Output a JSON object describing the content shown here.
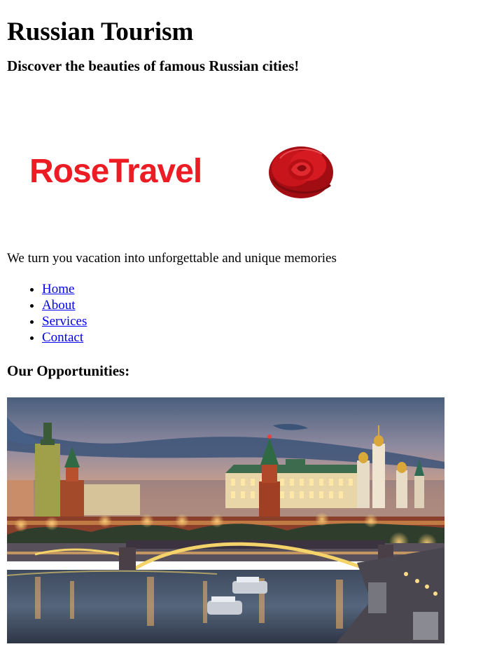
{
  "header": {
    "title": "Russian Tourism",
    "subtitle": "Discover the beauties of famous Russian cities!"
  },
  "logo": {
    "text": "RoseTravel",
    "text_color": "#ed1c24",
    "icon": "rose-icon"
  },
  "tagline": "We turn you vacation into unforgettable and unique memories",
  "nav": {
    "items": [
      {
        "label": "Home"
      },
      {
        "label": "About"
      },
      {
        "label": "Services"
      },
      {
        "label": "Contact"
      }
    ],
    "link_color": "#0000ee"
  },
  "section": {
    "title": "Our Opportunities:"
  },
  "hero": {
    "icon": "moscow-kremlin-night-photo"
  }
}
